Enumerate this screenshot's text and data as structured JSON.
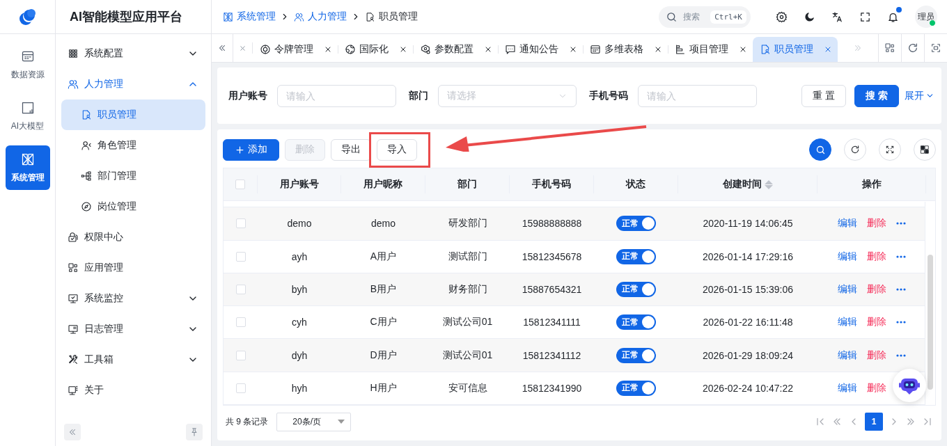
{
  "app": {
    "title": "AI智能模型应用平台"
  },
  "rail": [
    {
      "label": "数据资源",
      "selected": false
    },
    {
      "label": "AI大模型",
      "selected": false
    },
    {
      "label": "系统管理",
      "selected": true
    }
  ],
  "sidebar": {
    "items": [
      {
        "label": "系统配置",
        "expanded": false,
        "has_children": true,
        "selected": false
      },
      {
        "label": "人力管理",
        "expanded": true,
        "has_children": true,
        "selected": false,
        "children": [
          {
            "label": "职员管理",
            "selected": true
          },
          {
            "label": "角色管理",
            "selected": false
          },
          {
            "label": "部门管理",
            "selected": false
          },
          {
            "label": "岗位管理",
            "selected": false
          }
        ]
      },
      {
        "label": "权限中心",
        "expanded": false,
        "has_children": false,
        "selected": false
      },
      {
        "label": "应用管理",
        "expanded": false,
        "has_children": false,
        "selected": false
      },
      {
        "label": "系统监控",
        "expanded": false,
        "has_children": true,
        "selected": false
      },
      {
        "label": "日志管理",
        "expanded": false,
        "has_children": true,
        "selected": false
      },
      {
        "label": "工具箱",
        "expanded": false,
        "has_children": true,
        "selected": false
      },
      {
        "label": "关于",
        "expanded": false,
        "has_children": false,
        "selected": false
      }
    ]
  },
  "breadcrumb": [
    "系统管理",
    "人力管理",
    "职员管理"
  ],
  "header": {
    "search_placeholder": "搜索",
    "shortcut": "Ctrl+K",
    "notification_dot": true,
    "avatar": "理员",
    "online": true
  },
  "tabs": [
    {
      "label": "令牌管理",
      "selected": false
    },
    {
      "label": "国际化",
      "selected": false
    },
    {
      "label": "参数配置",
      "selected": false
    },
    {
      "label": "通知公告",
      "selected": false
    },
    {
      "label": "多维表格",
      "selected": false
    },
    {
      "label": "项目管理",
      "selected": false
    },
    {
      "label": "职员管理",
      "selected": true
    }
  ],
  "filters": [
    {
      "label": "用户账号",
      "kind": "input",
      "placeholder": "请输入"
    },
    {
      "label": "部门",
      "kind": "select",
      "placeholder": "请选择"
    },
    {
      "label": "手机号码",
      "kind": "input",
      "placeholder": "请输入"
    }
  ],
  "filter_buttons": {
    "reset": "重 置",
    "search": "搜 索",
    "expand": "展开"
  },
  "toolbar": [
    {
      "label": "添加",
      "kind": "primary",
      "disabled": false
    },
    {
      "label": "删除",
      "kind": "plain",
      "disabled": true
    },
    {
      "label": "导出",
      "kind": "plain",
      "disabled": false
    },
    {
      "label": "导入",
      "kind": "plain",
      "disabled": false
    }
  ],
  "table": {
    "all_checked": false,
    "columns": [
      "用户账号",
      "用户昵称",
      "部门",
      "手机号码",
      "状态",
      "创建时间",
      "操作"
    ],
    "rows": [
      {
        "checked": false,
        "account": "demo",
        "nickname": "demo",
        "dept": "研发部门",
        "phone": "15988888888",
        "status": "正常",
        "on": true,
        "created": "2020-11-19 14:06:45",
        "edit": "编辑",
        "delete": "删除"
      },
      {
        "checked": false,
        "account": "ayh",
        "nickname": "A用户",
        "dept": "测试部门",
        "phone": "15812345678",
        "status": "正常",
        "on": true,
        "created": "2026-01-14 17:29:16",
        "edit": "编辑",
        "delete": "删除"
      },
      {
        "checked": false,
        "account": "byh",
        "nickname": "B用户",
        "dept": "财务部门",
        "phone": "15887654321",
        "status": "正常",
        "on": true,
        "created": "2026-01-15 15:39:06",
        "edit": "编辑",
        "delete": "删除"
      },
      {
        "checked": false,
        "account": "cyh",
        "nickname": "C用户",
        "dept": "测试公司01",
        "phone": "15812341111",
        "status": "正常",
        "on": true,
        "created": "2026-01-22 16:11:48",
        "edit": "编辑",
        "delete": "删除"
      },
      {
        "checked": false,
        "account": "dyh",
        "nickname": "D用户",
        "dept": "测试公司01",
        "phone": "15812341112",
        "status": "正常",
        "on": true,
        "created": "2026-01-29 18:09:24",
        "edit": "编辑",
        "delete": "删除"
      },
      {
        "checked": false,
        "account": "hyh",
        "nickname": "H用户",
        "dept": "安可信息",
        "phone": "15812341990",
        "status": "正常",
        "on": true,
        "created": "2026-02-24 10:47:22",
        "edit": "编辑",
        "delete": "删除"
      }
    ]
  },
  "pagination": {
    "total": "共 9 条记录",
    "page_size": "20条/页",
    "pages": [
      {
        "label": "1",
        "selected": true
      }
    ]
  }
}
